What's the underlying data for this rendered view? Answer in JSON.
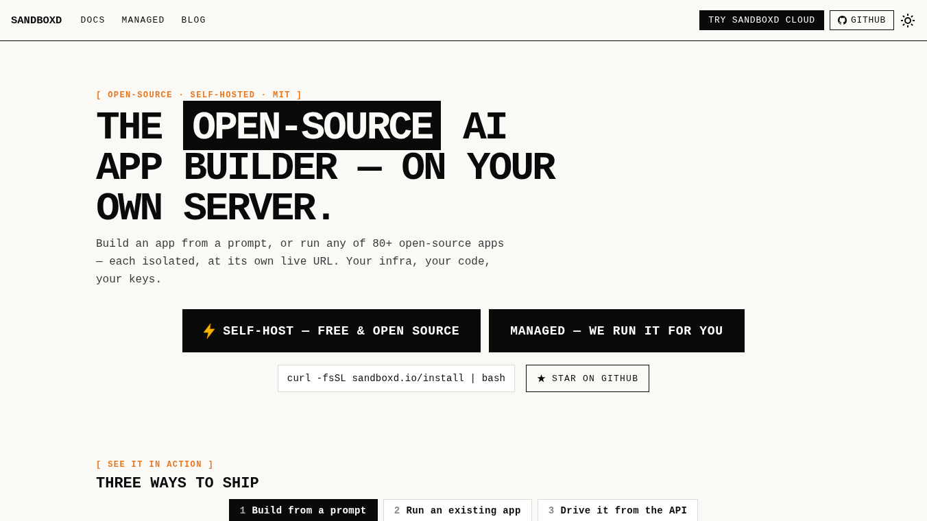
{
  "header": {
    "logo": "SANDBOXD",
    "nav": [
      {
        "label": "DOCS"
      },
      {
        "label": "MANAGED"
      },
      {
        "label": "BLOG"
      }
    ],
    "cloud_button": "TRY SANDBOXD CLOUD",
    "github_button": "GITHUB"
  },
  "hero": {
    "eyebrow": "[ OPEN-SOURCE · SELF-HOSTED · MIT ]",
    "headline": [
      {
        "text": "THE",
        "highlight": false
      },
      {
        "text": "OPEN-SOURCE",
        "highlight": true
      },
      {
        "text": "AI APP BUILDER — ON YOUR OWN SERVER.",
        "highlight": false
      }
    ],
    "description": "Build an app from a prompt, or run any of 80+ open-source apps — each isolated, at its own live URL. Your infra, your code, your keys.",
    "actions": [
      {
        "label": "SELF-HOST — FREE & OPEN SOURCE",
        "kind": "lightning"
      },
      {
        "label": "MANAGED — WE RUN IT FOR YOU",
        "kind": "plain"
      }
    ],
    "install_command": "curl -fsSL sandboxd.io/install | bash",
    "star_button": "STAR ON GITHUB"
  },
  "demo": {
    "eyebrow": "[ SEE IT IN ACTION ]",
    "title": "THREE WAYS TO SHIP",
    "tabs": [
      {
        "number": "1",
        "label": "Build from a prompt",
        "selected": true
      },
      {
        "number": "2",
        "label": "Run an existing app",
        "selected": false
      },
      {
        "number": "3",
        "label": "Drive it from the API",
        "selected": false
      }
    ]
  }
}
